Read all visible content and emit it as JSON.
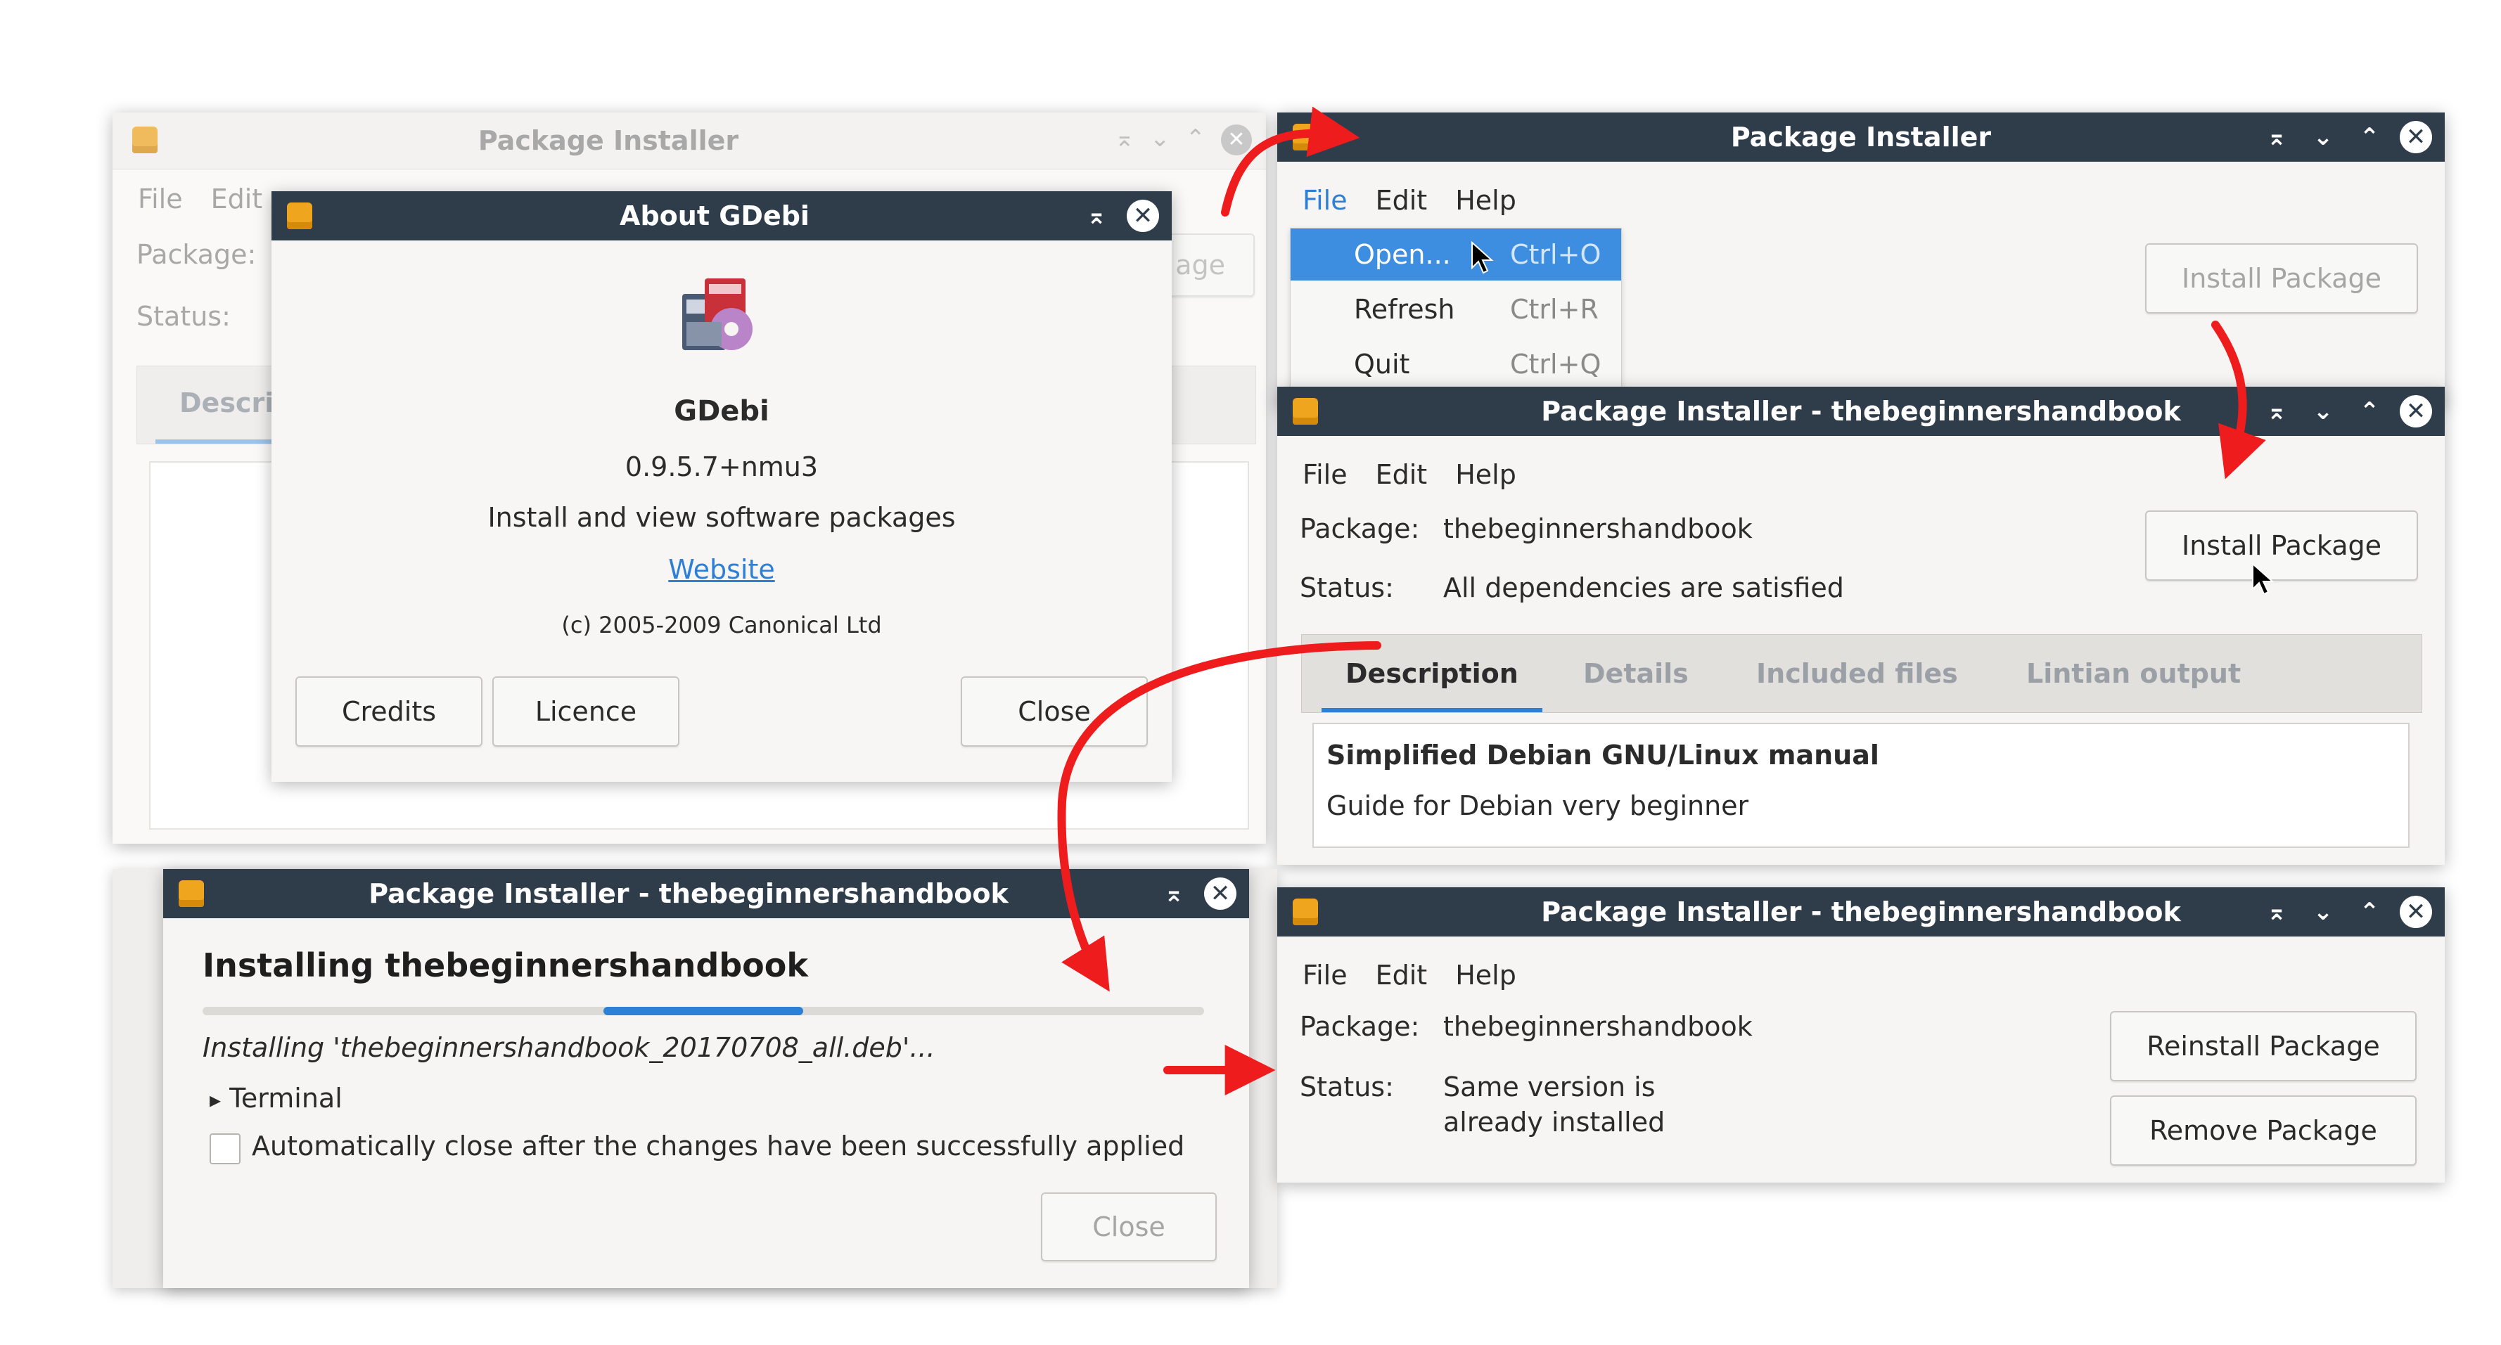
{
  "colors": {
    "titlebar": "#2f3d4b",
    "accent": "#2e7fd6",
    "arrow": "#ee1c1c",
    "window_bg": "#f6f5f4"
  },
  "icons": {
    "title_icon": "package-icon",
    "minimize_all": "⌅",
    "minimize": "⌄",
    "maximize": "⌃",
    "close": "✕",
    "expander": "▸",
    "app_logo": "gdebi-logo-icon"
  },
  "bg_window": {
    "title": "Package Installer",
    "menu": [
      "File",
      "Edit"
    ],
    "package_label": "Package:",
    "status_label": "Status:",
    "tab_label": "Descri",
    "button_fragment": "age"
  },
  "about_dialog": {
    "title": "About GDebi",
    "app_name": "GDebi",
    "version": "0.9.5.7+nmu3",
    "description": "Install and view software packages",
    "website": "Website",
    "copyright": "(c) 2005-2009 Canonical Ltd",
    "buttons": {
      "credits": "Credits",
      "licence": "Licence",
      "close": "Close"
    }
  },
  "window_menu": {
    "title": "Package Installer",
    "menu": [
      "File",
      "Edit",
      "Help"
    ],
    "dropdown": [
      {
        "label": "Open...",
        "shortcut": "Ctrl+O"
      },
      {
        "label": "Refresh",
        "shortcut": "Ctrl+R"
      },
      {
        "label": "Quit",
        "shortcut": "Ctrl+Q"
      }
    ],
    "install_button": "Install Package"
  },
  "window_install": {
    "title": "Package Installer - thebeginnershandbook",
    "menu": [
      "File",
      "Edit",
      "Help"
    ],
    "package_label": "Package:",
    "package_value": "thebeginnershandbook",
    "status_label": "Status:",
    "status_value": "All dependencies are satisfied",
    "install_button": "Install Package",
    "tabs": [
      "Description",
      "Details",
      "Included files",
      "Lintian output"
    ],
    "description_title": "Simplified Debian GNU/Linux manual",
    "description_body": "Guide for Debian very beginner"
  },
  "window_progress": {
    "title": "Package Installer - thebeginnershandbook",
    "heading": "Installing thebeginnershandbook",
    "progress": 0.2,
    "status_line": "Installing 'thebeginnershandbook_20170708_all.deb'...",
    "terminal": "Terminal",
    "auto_close": "Automatically close after the changes have been successfully applied",
    "auto_close_checked": false,
    "close_button": "Close"
  },
  "window_done": {
    "title": "Package Installer - thebeginnershandbook",
    "menu": [
      "File",
      "Edit",
      "Help"
    ],
    "package_label": "Package:",
    "package_value": "thebeginnershandbook",
    "status_label": "Status:",
    "status_value_line1": "Same version is",
    "status_value_line2": "already installed",
    "reinstall_button": "Reinstall Package",
    "remove_button": "Remove Package"
  }
}
